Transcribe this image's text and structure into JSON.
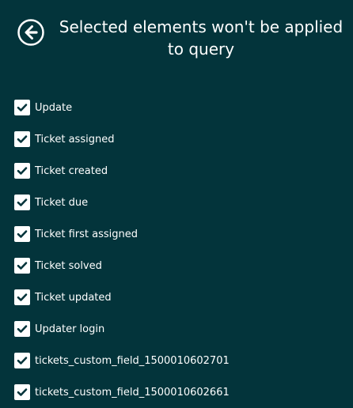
{
  "header": {
    "title": "Selected elements won't be applied to query",
    "back_icon": "arrow-left-circle-icon"
  },
  "colors": {
    "background": "#03343b",
    "text": "#ffffff",
    "checkbox_fill": "#ffffff",
    "checkmark": "#03343b"
  },
  "elements": [
    {
      "label": "Update",
      "checked": true
    },
    {
      "label": "Ticket assigned",
      "checked": true
    },
    {
      "label": "Ticket created",
      "checked": true
    },
    {
      "label": "Ticket due",
      "checked": true
    },
    {
      "label": "Ticket first assigned",
      "checked": true
    },
    {
      "label": "Ticket solved",
      "checked": true
    },
    {
      "label": "Ticket updated",
      "checked": true
    },
    {
      "label": "Updater login",
      "checked": true
    },
    {
      "label": "tickets_custom_field_1500010602701",
      "checked": true
    },
    {
      "label": "tickets_custom_field_1500010602661",
      "checked": true
    }
  ]
}
